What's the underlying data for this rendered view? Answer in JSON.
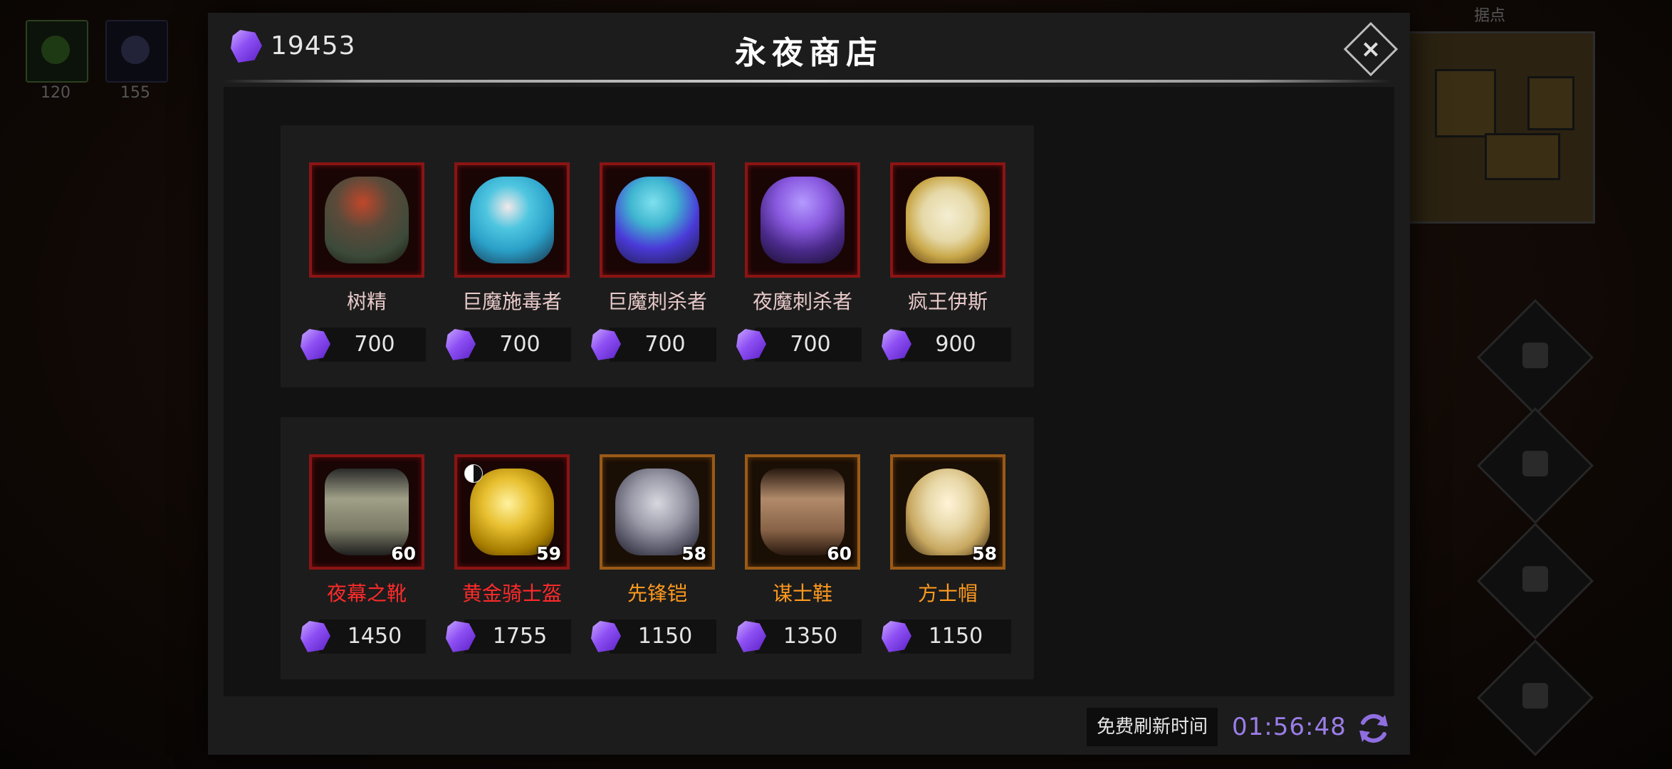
{
  "background": {
    "resources": [
      {
        "value": "120",
        "icon": "green-rune-icon"
      },
      {
        "value": "155",
        "icon": "dark-rune-icon"
      }
    ],
    "minimap_label": "据点"
  },
  "shop": {
    "title": "永夜商店",
    "currency": "19453",
    "currency_icon": "purple-gem-icon",
    "close_icon": "close-icon",
    "rows": [
      [
        {
          "name": "树精",
          "price": "700",
          "name_color": "#e8c9c9",
          "frame": "red"
        },
        {
          "name": "巨魔施毒者",
          "price": "700",
          "name_color": "#e8c9c9",
          "frame": "red"
        },
        {
          "name": "巨魔刺杀者",
          "price": "700",
          "name_color": "#e8c9c9",
          "frame": "red"
        },
        {
          "name": "夜魔刺杀者",
          "price": "700",
          "name_color": "#e8c9c9",
          "frame": "red"
        },
        {
          "name": "疯王伊斯",
          "price": "900",
          "name_color": "#e8c9c9",
          "frame": "red"
        }
      ],
      [
        {
          "name": "夜幕之靴",
          "price": "1450",
          "level": "60",
          "name_color": "#ff2a2a",
          "frame": "red"
        },
        {
          "name": "黄金骑士盔",
          "price": "1755",
          "level": "59",
          "name_color": "#ff2a2a",
          "frame": "red"
        },
        {
          "name": "先锋铠",
          "price": "1150",
          "level": "58",
          "name_color": "#ff9a1e",
          "frame": "orange"
        },
        {
          "name": "谋士鞋",
          "price": "1350",
          "level": "60",
          "name_color": "#ff9a1e",
          "frame": "orange"
        },
        {
          "name": "方士帽",
          "price": "1150",
          "level": "58",
          "name_color": "#ff9a1e",
          "frame": "orange"
        }
      ]
    ],
    "refresh_label": "免费刷新时间",
    "refresh_timer": "01:56:48",
    "refresh_icon": "refresh-icon",
    "accent_purple": "#9b7de8"
  }
}
